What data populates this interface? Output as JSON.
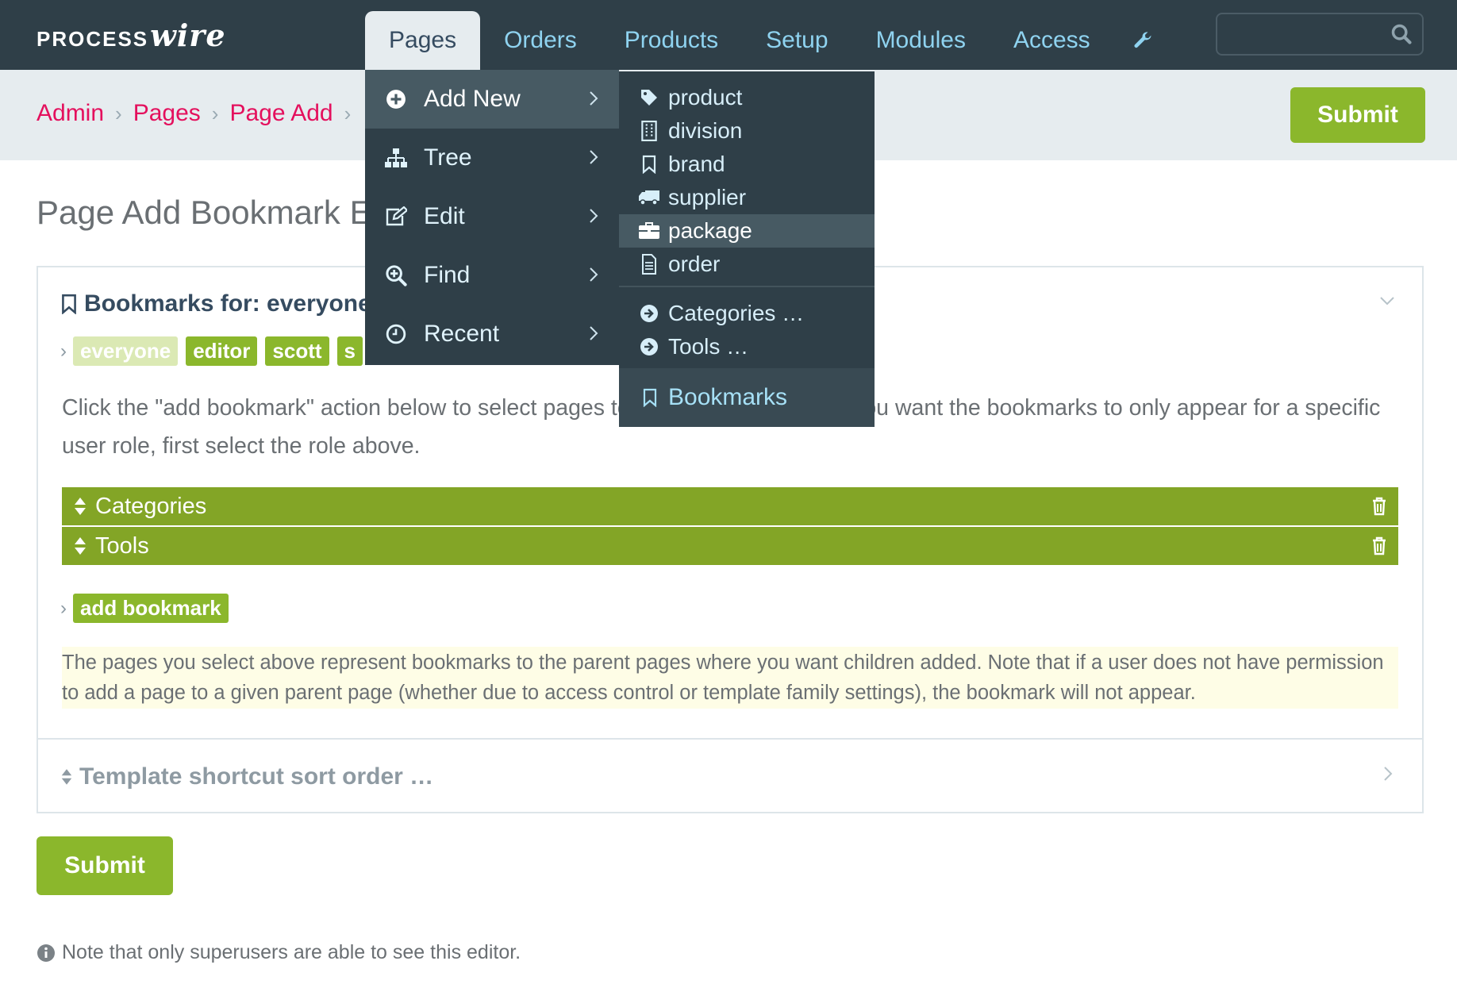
{
  "brand": {
    "part1": "PROCESS",
    "part2": "wire"
  },
  "topnav": {
    "items": [
      "Pages",
      "Orders",
      "Products",
      "Setup",
      "Modules",
      "Access"
    ],
    "tool_icon": "wrench-icon",
    "search_placeholder": ""
  },
  "breadcrumb": {
    "items": [
      "Admin",
      "Pages",
      "Page Add"
    ],
    "separator": "›"
  },
  "submit_label": "Submit",
  "page_title": "Page Add Bookmark Editor",
  "panel": {
    "title": "Bookmarks for: everyone",
    "roles": [
      "everyone",
      "editor",
      "scott",
      "s"
    ],
    "description": "Click the \"add bookmark\" action below to select pages to add as bookmarks. If you want the bookmarks to only appear for a specific user role, first select the role above.",
    "bookmarks": [
      "Categories",
      "Tools"
    ],
    "add_label": "add bookmark",
    "notes": "The pages you select above represent bookmarks to the parent pages where you want children added. Note that if a user does not have permission to add a page to a given parent page (whether due to access control or template family settings), the bookmark will not appear."
  },
  "template_sort": {
    "label": "Template shortcut sort order …"
  },
  "footnote": "Note that only superusers are able to see this editor.",
  "pages_menu": {
    "items": [
      {
        "label": "Add New",
        "icon": "plus-circle-icon"
      },
      {
        "label": "Tree",
        "icon": "sitemap-icon"
      },
      {
        "label": "Edit",
        "icon": "edit-icon"
      },
      {
        "label": "Find",
        "icon": "search-plus-icon"
      },
      {
        "label": "Recent",
        "icon": "clock-icon"
      }
    ]
  },
  "add_new_menu": {
    "templates": [
      {
        "label": "product",
        "icon": "tag-icon"
      },
      {
        "label": "division",
        "icon": "building-icon"
      },
      {
        "label": "brand",
        "icon": "bookmark-icon"
      },
      {
        "label": "supplier",
        "icon": "truck-icon"
      },
      {
        "label": "package",
        "icon": "briefcase-icon"
      },
      {
        "label": "order",
        "icon": "file-text-icon"
      }
    ],
    "bookmarks": [
      {
        "label": "Categories …",
        "icon": "arrow-circle-right-icon"
      },
      {
        "label": "Tools …",
        "icon": "arrow-circle-right-icon"
      }
    ],
    "bookmarks_label": "Bookmarks"
  },
  "colors": {
    "masthead": "#2f3f48",
    "accent": "#8bb72c",
    "link": "#e4105d",
    "menu_text": "#8fd3f0"
  }
}
